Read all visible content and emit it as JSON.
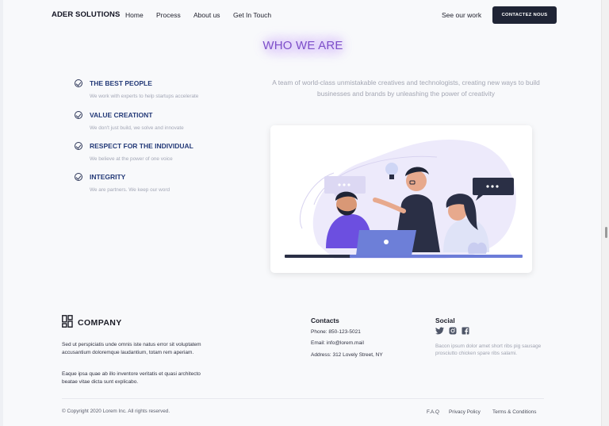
{
  "nav": {
    "brand": "ADER SOLUTIONS",
    "links": [
      "Home",
      "Process",
      "About us",
      "Get In Touch"
    ],
    "see_work": "See our work",
    "cta": "CONTACTEZ NOUS"
  },
  "who": {
    "title": "WHO WE ARE",
    "intro": "A team of world-class unmistakable creatives and technologists, creating new ways to build businesses and brands by unleashing the power of creativity",
    "values": [
      {
        "title": "THE BEST PEOPLE",
        "desc": "We work with experts to help startups accelerate"
      },
      {
        "title": "VALUE CREATIONT",
        "desc": "We don't just build, we solve and innovate"
      },
      {
        "title": "RESPECT FOR THE INDIVIDUAL",
        "desc": "We believe at the power of one voice"
      },
      {
        "title": "INTEGRITY",
        "desc": "We are partners. We keep our word"
      }
    ]
  },
  "footer": {
    "company": "COMPANY",
    "about_1": "Sed ut perspiciatis unde omnis iste natus error sit voluptatem accusantium doloremque laudantium, totam rem aperiam.",
    "about_2": "Eaque ipsa quae ab illo inventore veritatis et quasi architecto beatae vitae dicta sunt explicabo.",
    "contacts_title": "Contacts",
    "phone": "Phone: 850-123-5021",
    "email": "Email: info@lorem.mail",
    "address": "Address: 312 Lovely Street, NY",
    "social_title": "Social",
    "social_icons": [
      "twitter-icon",
      "instagram-icon",
      "facebook-icon"
    ],
    "social_text": "Bacon ipsum dolor amet short ribs pig sausage prosciutto chicken spare ribs salami.",
    "copyright": "© Copyright 2020 Lorem Inc. All rights reserved.",
    "links": [
      "F.A.Q",
      "Privacy Policy",
      "Terms & Conditions"
    ]
  },
  "colors": {
    "accent": "#7d4fc9",
    "navy": "#1f2435",
    "value_title": "#243a78"
  }
}
